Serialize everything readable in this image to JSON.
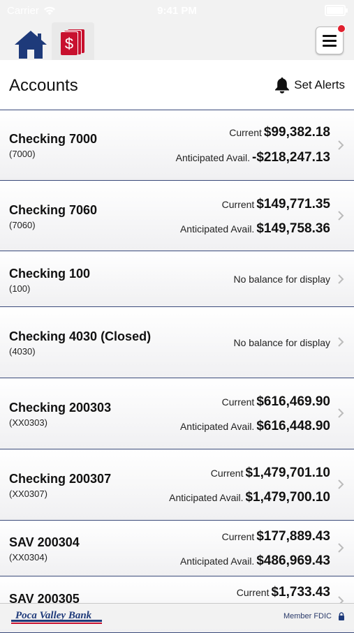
{
  "status_bar": {
    "carrier": "Carrier",
    "time": "9:41 PM"
  },
  "header": {
    "title": "Accounts",
    "set_alerts": "Set Alerts"
  },
  "labels": {
    "current": "Current",
    "anticipated": "Anticipated Avail.",
    "no_balance": "No balance for display"
  },
  "accounts": [
    {
      "name": "Checking 7000",
      "number": "(7000)",
      "current": "$99,382.18",
      "anticipated": "-$218,247.13"
    },
    {
      "name": "Checking 7060",
      "number": "(7060)",
      "current": "$149,771.35",
      "anticipated": "$149,758.36"
    },
    {
      "name": "Checking 100",
      "number": "(100)",
      "no_balance": true
    },
    {
      "name": "Checking 4030 (Closed)",
      "number": "(4030)",
      "no_balance": true
    },
    {
      "name": "Checking 200303",
      "number": "(XX0303)",
      "current": "$616,469.90",
      "anticipated": "$616,448.90"
    },
    {
      "name": "Checking 200307",
      "number": "(XX0307)",
      "current": "$1,479,701.10",
      "anticipated": "$1,479,700.10"
    },
    {
      "name": "SAV 200304",
      "number": "(XX0304)",
      "current": "$177,889.43",
      "anticipated": "$486,969.43"
    },
    {
      "name": "SAV 200305",
      "number": "",
      "current": "$1,733.43"
    }
  ],
  "footer": {
    "bank_name": "Poca Valley Bank",
    "member_fdic": "Member FDIC"
  },
  "colors": {
    "navy": "#1e3a7a",
    "brand_red": "#c8102e",
    "divider": "#3a4a7a",
    "notification": "#e0202e"
  },
  "icons": {
    "home": "home-icon",
    "accounts": "dollar-cards-icon",
    "menu": "hamburger-menu-icon",
    "bell": "bell-icon",
    "chevron": "chevron-right-icon",
    "lock": "lock-icon"
  }
}
